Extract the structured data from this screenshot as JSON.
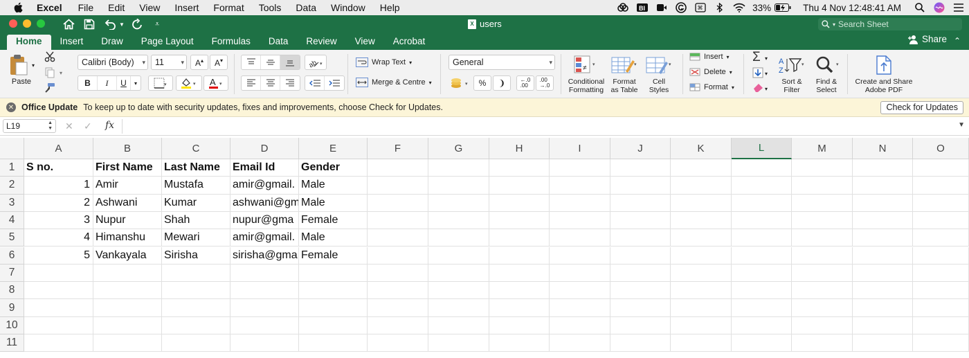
{
  "menubar": {
    "app": "Excel",
    "items": [
      "File",
      "Edit",
      "View",
      "Insert",
      "Format",
      "Tools",
      "Data",
      "Window",
      "Help"
    ],
    "battery": "33%",
    "clock": "Thu 4 Nov  12:48:41 AM"
  },
  "window": {
    "doc_title": "users",
    "search_placeholder": "Search Sheet",
    "share_label": "Share",
    "tabs": [
      "Home",
      "Insert",
      "Draw",
      "Page Layout",
      "Formulas",
      "Data",
      "Review",
      "View",
      "Acrobat"
    ],
    "active_tab": "Home"
  },
  "ribbon": {
    "paste_label": "Paste",
    "font_name": "Calibri (Body)",
    "font_size": "11",
    "bold": "B",
    "italic": "I",
    "underline": "U",
    "wrap_text": "Wrap Text",
    "merge_centre": "Merge & Centre",
    "number_format": "General",
    "percent": "%",
    "comma": "❩",
    "conditional_formatting": [
      "Conditional",
      "Formatting"
    ],
    "format_as_table": [
      "Format",
      "as Table"
    ],
    "cell_styles": [
      "Cell",
      "Styles"
    ],
    "insert": "Insert",
    "delete": "Delete",
    "format": "Format",
    "sort_filter": [
      "Sort &",
      "Filter"
    ],
    "find_select": [
      "Find &",
      "Select"
    ],
    "create_pdf": [
      "Create and Share",
      "Adobe PDF"
    ],
    "accent": "#1e7145"
  },
  "update_bar": {
    "title": "Office Update",
    "message": "To keep up to date with security updates, fixes and improvements, choose Check for Updates.",
    "button": "Check for Updates"
  },
  "formula_bar": {
    "name_box": "L19",
    "fx": "fx",
    "value": ""
  },
  "sheet": {
    "columns": [
      "A",
      "B",
      "C",
      "D",
      "E",
      "F",
      "G",
      "H",
      "I",
      "J",
      "K",
      "L",
      "M",
      "N",
      "O"
    ],
    "selected_column": "L",
    "rows": [
      "1",
      "2",
      "3",
      "4",
      "5",
      "6",
      "7",
      "8",
      "9",
      "10",
      "11"
    ],
    "header": [
      "S no.",
      "First Name",
      "Last Name",
      "Email Id",
      "Gender"
    ],
    "data": [
      [
        "1",
        "Amir",
        "Mustafa",
        "amir@gmail.",
        "Male"
      ],
      [
        "2",
        "Ashwani",
        "Kumar",
        "ashwani@gm",
        "Male"
      ],
      [
        "3",
        "Nupur",
        "Shah",
        "nupur@gma",
        "Female"
      ],
      [
        "4",
        "Himanshu",
        "Mewari",
        "amir@gmail.",
        "Male"
      ],
      [
        "5",
        "Vankayala",
        "Sirisha",
        "sirisha@gma",
        "Female"
      ]
    ]
  }
}
